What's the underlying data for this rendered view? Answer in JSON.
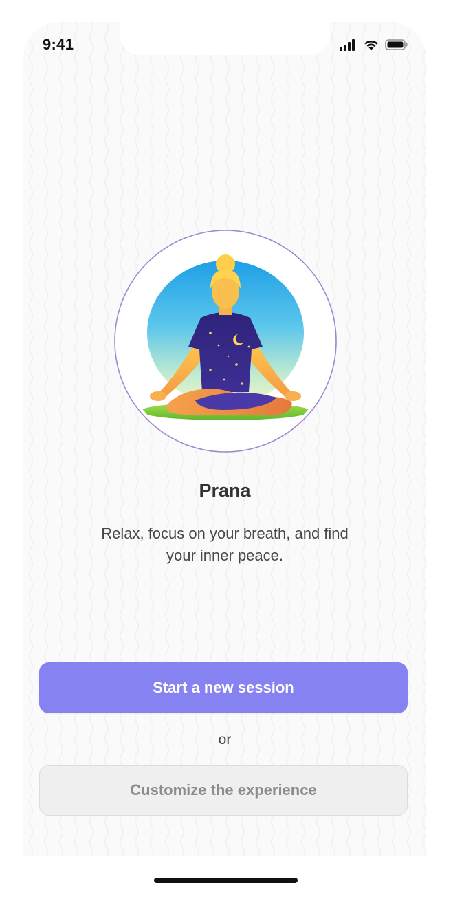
{
  "status_bar": {
    "time": "9:41"
  },
  "app": {
    "title": "Prana",
    "description": "Relax, focus on your breath, and find your inner peace."
  },
  "actions": {
    "primary_label": "Start a new session",
    "separator": "or",
    "secondary_label": "Customize the experience"
  },
  "icons": [
    "signal-icon",
    "wifi-icon",
    "battery-icon",
    "meditation-illustration"
  ],
  "colors": {
    "accent": "#8782f2",
    "ring": "#9b88d0",
    "secondary_bg": "#efefef",
    "secondary_text": "#8c8c8c"
  }
}
